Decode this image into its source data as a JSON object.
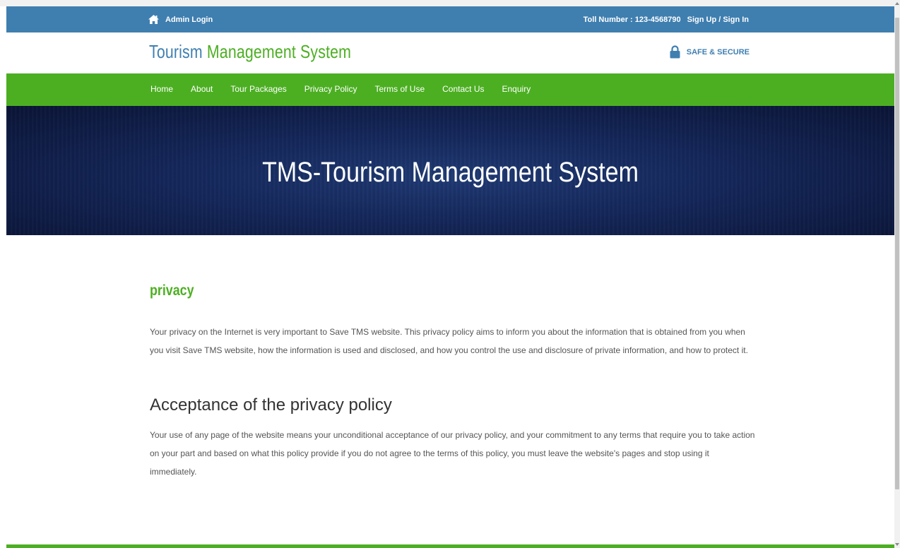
{
  "topbar": {
    "admin_login": "Admin Login",
    "toll_number": "Toll Number : 123-4568790",
    "signup_signin": "Sign Up / Sign In",
    "home_icon": "home-icon"
  },
  "header": {
    "logo_part1": "Tourism",
    "logo_part2": " Management System",
    "secure_label": "SAFE & SECURE",
    "lock_icon": "lock-icon"
  },
  "nav": {
    "items": [
      "Home",
      "About",
      "Tour Packages",
      "Privacy Policy",
      "Terms of Use",
      "Contact Us",
      "Enquiry"
    ]
  },
  "banner": {
    "title": "TMS-Tourism Management System"
  },
  "content": {
    "section_heading": "privacy",
    "privacy_text": "Your privacy on the Internet is very important to Save TMS website. This privacy policy aims to inform you about the information that is obtained from you when you visit Save TMS website, how the information is used and disclosed, and how you control the use and disclosure of private information, and how to protect it.",
    "acceptance_heading": "Acceptance of the privacy policy",
    "acceptance_text": "Your use of any page of the website means your unconditional acceptance of our privacy policy, and your commitment to any terms that require you to take action on your part and based on what this policy provide if you do not agree to the terms of this policy, you must leave the website's pages and stop using it immediately."
  },
  "colors": {
    "topbar_blue": "#3f7fb0",
    "accent_green": "#4caf22",
    "banner_navy": "#142659"
  }
}
